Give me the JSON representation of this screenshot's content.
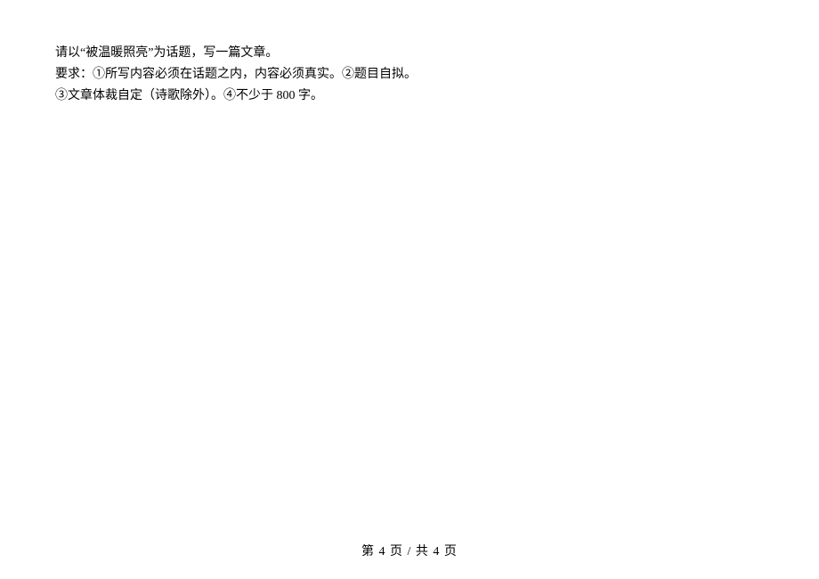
{
  "body": {
    "line1": "请以“被温暖照亮”为话题，写一篇文章。",
    "line2": "要求：①所写内容必须在话题之内，内容必须真实。②题目自拟。",
    "line3": "③文章体裁自定（诗歌除外）。④不少于 800 字。"
  },
  "footer": {
    "text": "第 4 页  /  共 4 页"
  }
}
